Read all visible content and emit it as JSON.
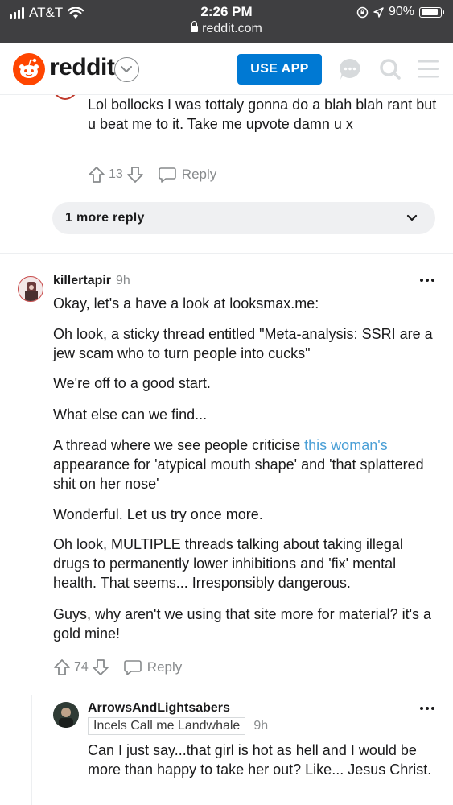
{
  "status_bar": {
    "carrier": "AT&T",
    "time": "2:26 PM",
    "url": "reddit.com",
    "battery": "90%",
    "battery_level": 0.9
  },
  "header": {
    "wordmark": "reddit",
    "use_app_label": "USE APP",
    "icons": [
      "reddit-logo-icon",
      "chevron-down-icon",
      "chat-icon",
      "search-icon",
      "menu-icon"
    ]
  },
  "colors": {
    "brand": "#ff4500",
    "use_app_button": "#0079d3",
    "link": "#4a9fd6",
    "muted": "#878a8c"
  },
  "prev_comment": {
    "text": "Lol bollocks I was tottaly gonna do a blah blah rant but u beat me to it. Take me upvote damn u x",
    "votes": "13",
    "reply_label": "Reply",
    "more_replies": "1 more reply"
  },
  "comment": {
    "username": "killertapir",
    "time": "9h",
    "paragraphs": [
      "Okay, let's a have a look at looksmax.me:",
      "Oh look, a sticky thread entitled \"Meta-analysis: SSRI are a jew scam who to turn people into cucks\"",
      "We're off to a good start.",
      "What else can we find..."
    ],
    "p5_before": "A thread where we see people criticise ",
    "p5_link": "this woman's",
    "p5_after": " appearance for 'atypical mouth shape' and 'that splattered shit on her nose'",
    "paragraphs_after": [
      "Wonderful. Let us try once more.",
      "Oh look, MULTIPLE threads talking about taking illegal drugs to permanently lower inhibitions and 'fix' mental health. That seems... Irresponsibly dangerous.",
      "Guys, why aren't we using that site more for material? it's a gold mine!"
    ],
    "votes": "74",
    "reply_label": "Reply"
  },
  "reply": {
    "username": "ArrowsAndLightsabers",
    "flair": "Incels Call me Landwhale",
    "time": "9h",
    "text": "Can I just say...that girl is hot as hell and I would be more than happy to take her out? Like... Jesus Christ."
  }
}
